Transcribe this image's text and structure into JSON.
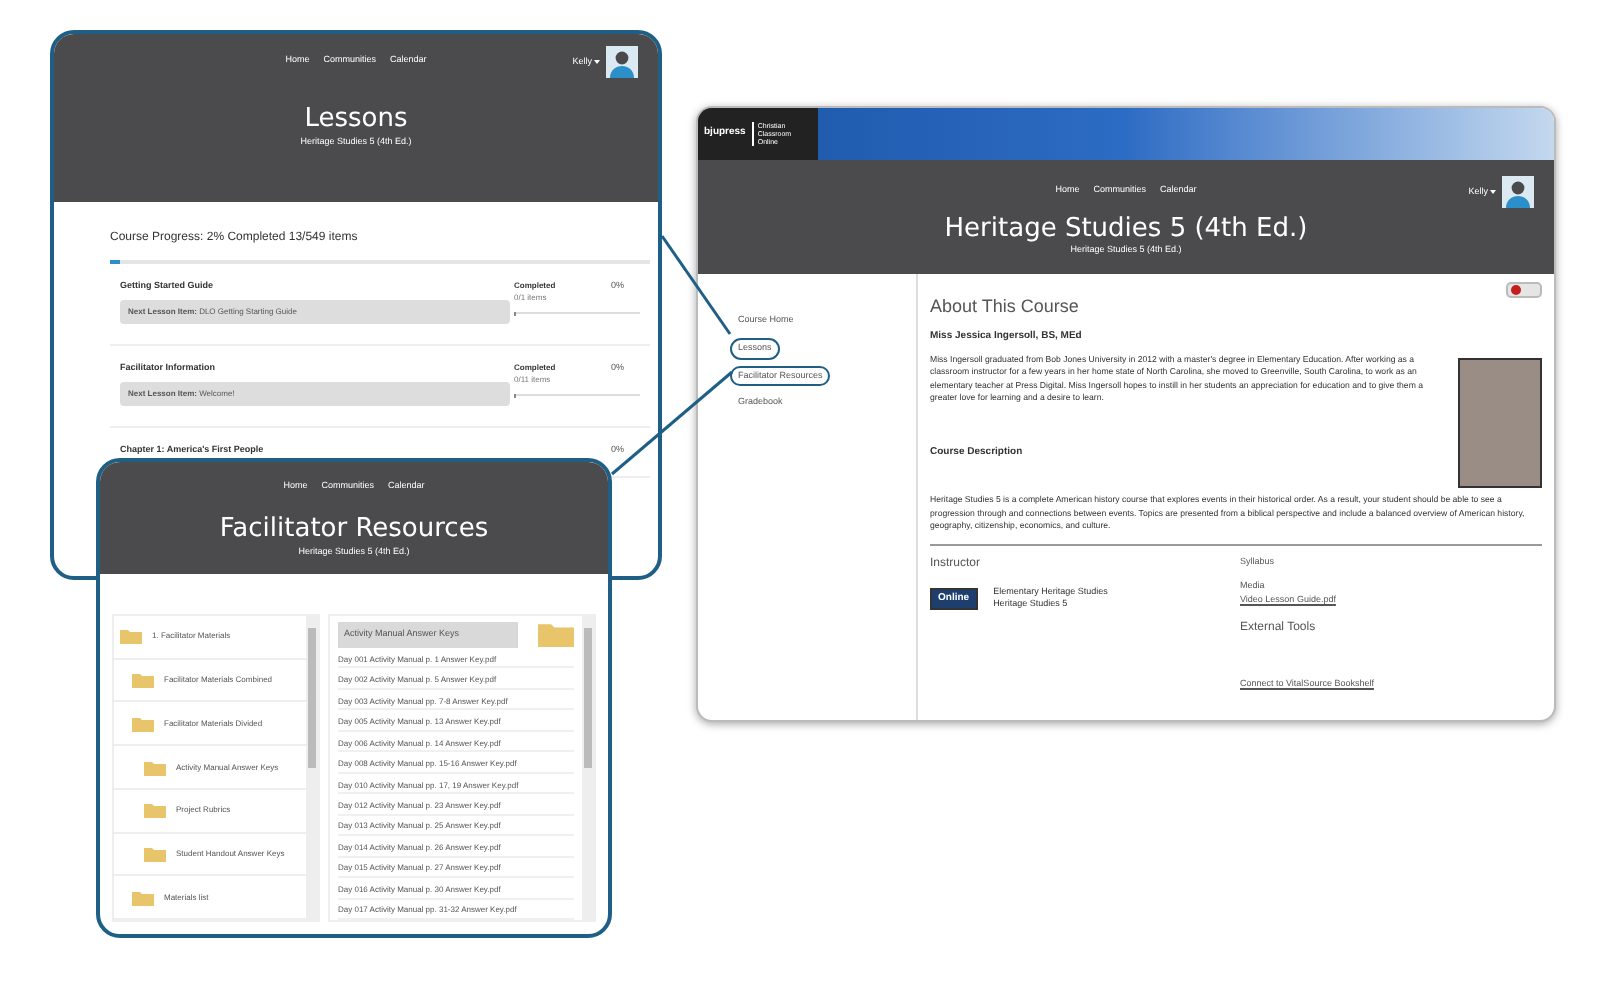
{
  "lessons_window": {
    "nav": [
      "Home",
      "Communities",
      "Calendar"
    ],
    "user": "Kelly",
    "title": "Lessons",
    "subtitle": "Heritage Studies 5 (4th Ed.)",
    "progress": {
      "label": "Course Progress: 2% Completed 13/549 items",
      "level": 0.02
    },
    "sections": [
      {
        "title": "Getting Started Guide",
        "next": "**Next Lesson Item:** DLO Getting Starting Guide",
        "status": "Completed",
        "count": "0/1 items",
        "percent": "0%",
        "level": 0
      },
      {
        "title": "Facilitator Information",
        "next": "**Next Lesson Item:** Welcome!",
        "status": "Completed",
        "count": "0/11 items",
        "percent": "0%",
        "level": 0
      },
      {
        "title": "Chapter 1: America's First People",
        "percent": "0%"
      }
    ]
  },
  "resources_window": {
    "nav": [
      "Home",
      "Communities",
      "Calendar"
    ],
    "title": "Facilitator Resources",
    "subtitle": "Heritage Studies 5 (4th Ed.)",
    "tree": [
      {
        "label": "1. Facilitator Materials",
        "children": [
          {
            "label": "Facilitator Materials Combined"
          },
          {
            "label": "Facilitator Materials Divided",
            "children": [
              {
                "label": "Activity Manual Answer Keys"
              },
              {
                "label": "Project Rubrics"
              },
              {
                "label": "Student Handout Answer Keys"
              }
            ]
          },
          {
            "label": "Materials list"
          }
        ]
      }
    ],
    "folder_title": "Activity Manual Answer Keys",
    "files": [
      "Day 001 Activity Manual p. 1 Answer Key.pdf",
      "Day 002 Activity Manual p. 5 Answer Key.pdf",
      "Day 003 Activity Manual pp. 7-8 Answer Key.pdf",
      "Day 005 Activity Manual p. 13 Answer Key.pdf",
      "Day 006 Activity Manual p. 14 Answer Key.pdf",
      "Day 008 Activity Manual pp. 15-16 Answer Key.pdf",
      "Day 010 Activity Manual pp. 17, 19 Answer Key.pdf",
      "Day 012 Activity Manual p. 23 Answer Key.pdf",
      "Day 013 Activity Manual p. 25 Answer Key.pdf",
      "Day 014 Activity Manual p. 26 Answer Key.pdf",
      "Day 015 Activity Manual p. 27 Answer Key.pdf",
      "Day 016 Activity Manual p. 30 Answer Key.pdf",
      "Day 017 Activity Manual pp. 31-32 Answer Key.pdf"
    ]
  },
  "course_window": {
    "brand": {
      "name": "bjupress",
      "product": "Christian Classroom Online"
    },
    "nav": [
      "Home",
      "Communities",
      "Calendar"
    ],
    "user": "Kelly",
    "title": "Heritage Studies 5 (4th Ed.)",
    "subtitle": "Heritage Studies 5 (4th Ed.)",
    "sidebar": [
      {
        "label": "Course Home",
        "highlighted": false
      },
      {
        "label": "Lessons",
        "highlighted": true
      },
      {
        "label": "Facilitator Resources",
        "highlighted": true
      },
      {
        "label": "Gradebook",
        "highlighted": false
      }
    ],
    "heading": "About This Course",
    "teacher": "Miss Jessica Ingersoll, BS, MEd",
    "bio": "Miss Ingersoll graduated from Bob Jones University in 2012 with a master's degree in Elementary Education. After working as a classroom instructor for a few years in her home state of North Carolina, she moved to Greenville, South Carolina, to work as an elementary teacher at Press Digital. Miss Ingersoll hopes to instill in her students an appreciation for education and to give them a greater love for learning and a desire to learn.",
    "description_heading": "Course Description",
    "description": "Heritage Studies 5 is a complete American history course that explores events in their historical order. As a result, your student should be able to see a progression through and connections between events. Topics are presented from a biblical perspective and include a balanced overview of American history, geography, citizenship, economics, and culture.",
    "instructor_heading": "Instructor",
    "instructor_badge": "Online",
    "instructor_course": "Elementary Heritage Studies Heritage Studies 5",
    "syllabus": "Syllabus",
    "media": "Media",
    "media_link": "Video Lesson Guide.pdf",
    "tools_heading": "External Tools",
    "tools_link": "Connect to VitalSource Bookshelf"
  }
}
